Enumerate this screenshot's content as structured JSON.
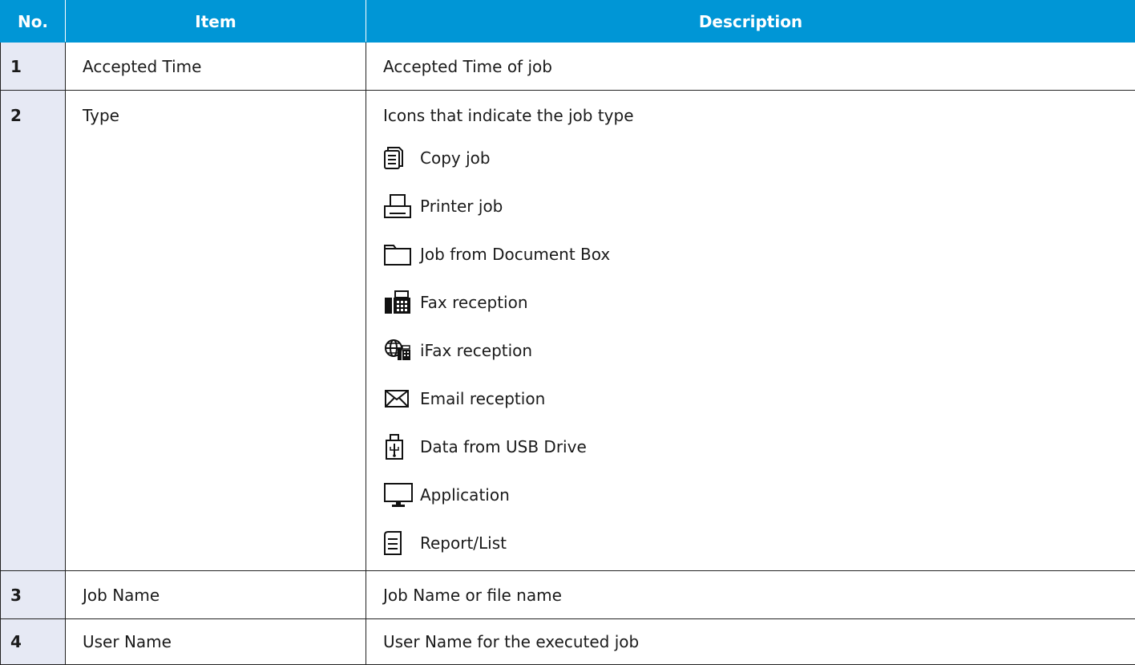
{
  "header": {
    "no": "No.",
    "item": "Item",
    "description": "Description"
  },
  "rows": [
    {
      "no": "1",
      "item": "Accepted Time",
      "description": "Accepted Time of job"
    },
    {
      "no": "2",
      "item": "Type",
      "description": "Icons that indicate the job type",
      "types": [
        {
          "icon": "copy-job-icon",
          "label": "Copy job"
        },
        {
          "icon": "printer-icon",
          "label": "Printer job"
        },
        {
          "icon": "folder-icon",
          "label": "Job from Document Box"
        },
        {
          "icon": "fax-icon",
          "label": "Fax reception"
        },
        {
          "icon": "ifax-globe-icon",
          "label": "iFax reception"
        },
        {
          "icon": "email-envelope-icon",
          "label": "Email reception"
        },
        {
          "icon": "usb-drive-icon",
          "label": "Data from USB Drive"
        },
        {
          "icon": "monitor-icon",
          "label": "Application"
        },
        {
          "icon": "report-list-icon",
          "label": "Report/List"
        }
      ]
    },
    {
      "no": "3",
      "item": "Job Name",
      "description": "Job Name or file name"
    },
    {
      "no": "4",
      "item": "User Name",
      "description": "User Name for the executed job"
    }
  ],
  "colors": {
    "header_bg": "#0096d6",
    "number_cell_bg": "#e6e9f4"
  }
}
